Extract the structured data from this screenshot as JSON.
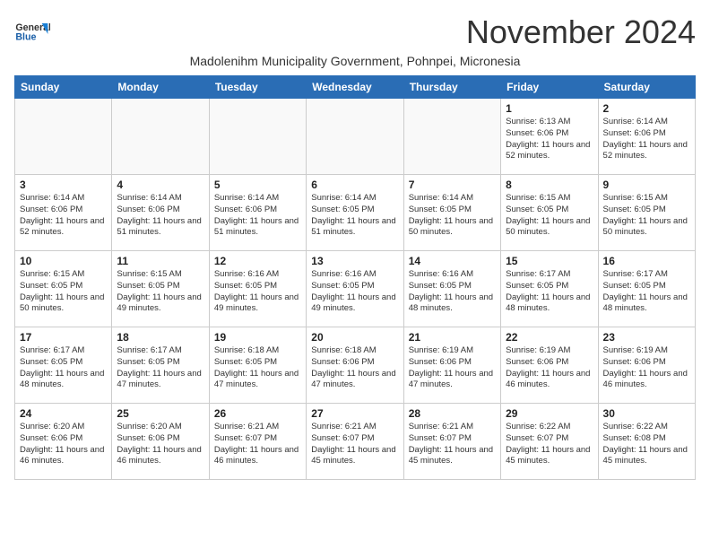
{
  "header": {
    "logo_line1": "General",
    "logo_line2": "Blue",
    "month_title": "November 2024",
    "subtitle": "Madolenihm Municipality Government, Pohnpei, Micronesia"
  },
  "weekdays": [
    "Sunday",
    "Monday",
    "Tuesday",
    "Wednesday",
    "Thursday",
    "Friday",
    "Saturday"
  ],
  "weeks": [
    [
      {
        "day": "",
        "content": ""
      },
      {
        "day": "",
        "content": ""
      },
      {
        "day": "",
        "content": ""
      },
      {
        "day": "",
        "content": ""
      },
      {
        "day": "",
        "content": ""
      },
      {
        "day": "1",
        "content": "Sunrise: 6:13 AM\nSunset: 6:06 PM\nDaylight: 11 hours and 52 minutes."
      },
      {
        "day": "2",
        "content": "Sunrise: 6:14 AM\nSunset: 6:06 PM\nDaylight: 11 hours and 52 minutes."
      }
    ],
    [
      {
        "day": "3",
        "content": "Sunrise: 6:14 AM\nSunset: 6:06 PM\nDaylight: 11 hours and 52 minutes."
      },
      {
        "day": "4",
        "content": "Sunrise: 6:14 AM\nSunset: 6:06 PM\nDaylight: 11 hours and 51 minutes."
      },
      {
        "day": "5",
        "content": "Sunrise: 6:14 AM\nSunset: 6:06 PM\nDaylight: 11 hours and 51 minutes."
      },
      {
        "day": "6",
        "content": "Sunrise: 6:14 AM\nSunset: 6:05 PM\nDaylight: 11 hours and 51 minutes."
      },
      {
        "day": "7",
        "content": "Sunrise: 6:14 AM\nSunset: 6:05 PM\nDaylight: 11 hours and 50 minutes."
      },
      {
        "day": "8",
        "content": "Sunrise: 6:15 AM\nSunset: 6:05 PM\nDaylight: 11 hours and 50 minutes."
      },
      {
        "day": "9",
        "content": "Sunrise: 6:15 AM\nSunset: 6:05 PM\nDaylight: 11 hours and 50 minutes."
      }
    ],
    [
      {
        "day": "10",
        "content": "Sunrise: 6:15 AM\nSunset: 6:05 PM\nDaylight: 11 hours and 50 minutes."
      },
      {
        "day": "11",
        "content": "Sunrise: 6:15 AM\nSunset: 6:05 PM\nDaylight: 11 hours and 49 minutes."
      },
      {
        "day": "12",
        "content": "Sunrise: 6:16 AM\nSunset: 6:05 PM\nDaylight: 11 hours and 49 minutes."
      },
      {
        "day": "13",
        "content": "Sunrise: 6:16 AM\nSunset: 6:05 PM\nDaylight: 11 hours and 49 minutes."
      },
      {
        "day": "14",
        "content": "Sunrise: 6:16 AM\nSunset: 6:05 PM\nDaylight: 11 hours and 48 minutes."
      },
      {
        "day": "15",
        "content": "Sunrise: 6:17 AM\nSunset: 6:05 PM\nDaylight: 11 hours and 48 minutes."
      },
      {
        "day": "16",
        "content": "Sunrise: 6:17 AM\nSunset: 6:05 PM\nDaylight: 11 hours and 48 minutes."
      }
    ],
    [
      {
        "day": "17",
        "content": "Sunrise: 6:17 AM\nSunset: 6:05 PM\nDaylight: 11 hours and 48 minutes."
      },
      {
        "day": "18",
        "content": "Sunrise: 6:17 AM\nSunset: 6:05 PM\nDaylight: 11 hours and 47 minutes."
      },
      {
        "day": "19",
        "content": "Sunrise: 6:18 AM\nSunset: 6:05 PM\nDaylight: 11 hours and 47 minutes."
      },
      {
        "day": "20",
        "content": "Sunrise: 6:18 AM\nSunset: 6:06 PM\nDaylight: 11 hours and 47 minutes."
      },
      {
        "day": "21",
        "content": "Sunrise: 6:19 AM\nSunset: 6:06 PM\nDaylight: 11 hours and 47 minutes."
      },
      {
        "day": "22",
        "content": "Sunrise: 6:19 AM\nSunset: 6:06 PM\nDaylight: 11 hours and 46 minutes."
      },
      {
        "day": "23",
        "content": "Sunrise: 6:19 AM\nSunset: 6:06 PM\nDaylight: 11 hours and 46 minutes."
      }
    ],
    [
      {
        "day": "24",
        "content": "Sunrise: 6:20 AM\nSunset: 6:06 PM\nDaylight: 11 hours and 46 minutes."
      },
      {
        "day": "25",
        "content": "Sunrise: 6:20 AM\nSunset: 6:06 PM\nDaylight: 11 hours and 46 minutes."
      },
      {
        "day": "26",
        "content": "Sunrise: 6:21 AM\nSunset: 6:07 PM\nDaylight: 11 hours and 46 minutes."
      },
      {
        "day": "27",
        "content": "Sunrise: 6:21 AM\nSunset: 6:07 PM\nDaylight: 11 hours and 45 minutes."
      },
      {
        "day": "28",
        "content": "Sunrise: 6:21 AM\nSunset: 6:07 PM\nDaylight: 11 hours and 45 minutes."
      },
      {
        "day": "29",
        "content": "Sunrise: 6:22 AM\nSunset: 6:07 PM\nDaylight: 11 hours and 45 minutes."
      },
      {
        "day": "30",
        "content": "Sunrise: 6:22 AM\nSunset: 6:08 PM\nDaylight: 11 hours and 45 minutes."
      }
    ]
  ]
}
